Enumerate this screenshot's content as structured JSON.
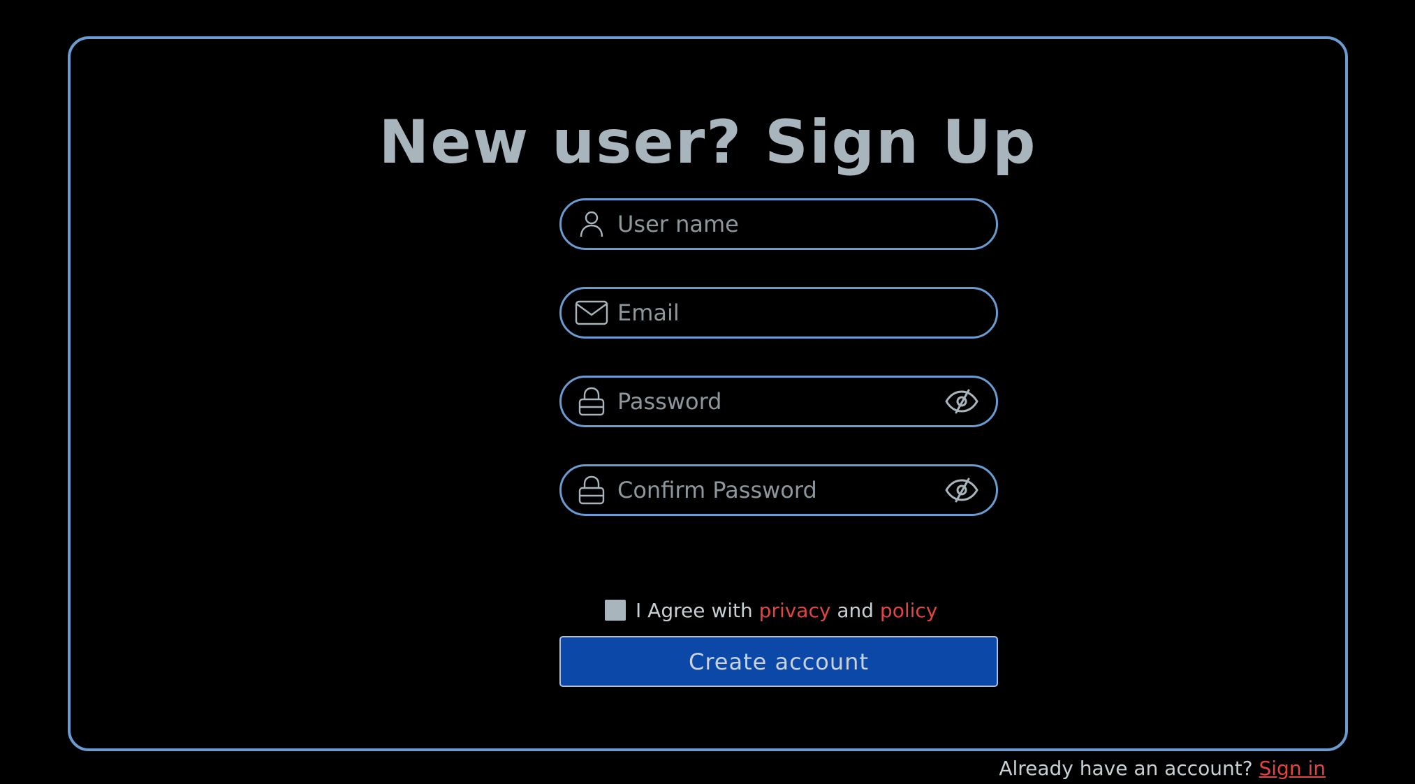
{
  "form": {
    "title": "New user? Sign Up",
    "fields": {
      "username": {
        "placeholder": "User name",
        "icon": "user-icon"
      },
      "email": {
        "placeholder": "Email",
        "icon": "mail-icon"
      },
      "password": {
        "placeholder": "Password",
        "icon": "lock-icon",
        "toggle_icon": "eye-slash-icon"
      },
      "confirm_password": {
        "placeholder": "Confirm Password",
        "icon": "lock-icon",
        "toggle_icon": "eye-slash-icon"
      }
    },
    "agree": {
      "prefix": "I Agree with",
      "privacy_link": "privacy",
      "connector": "and",
      "policy_link": "policy"
    },
    "submit_label": "Create account",
    "footer": {
      "prompt": "Already have an account?",
      "signin_link": "Sign in"
    }
  },
  "colors": {
    "background": "#000000",
    "border": "#6a9bd1",
    "title": "#a9b5bc",
    "link": "#e04444",
    "button": "#0b48a8"
  }
}
